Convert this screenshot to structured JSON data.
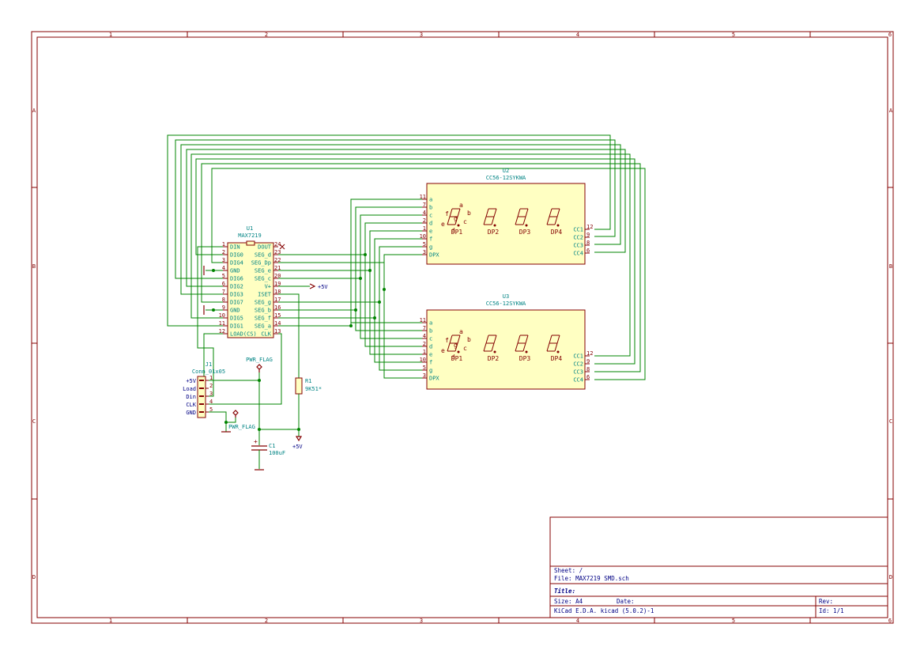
{
  "zones": {
    "columns": [
      "1",
      "2",
      "3",
      "4",
      "5",
      "6"
    ],
    "rows": [
      "A",
      "B",
      "C",
      "D"
    ]
  },
  "u1": {
    "ref": "U1",
    "value": "MAX7219",
    "left_pins": [
      {
        "num": "1",
        "name": "DIN"
      },
      {
        "num": "2",
        "name": "DIG0"
      },
      {
        "num": "3",
        "name": "DIG4"
      },
      {
        "num": "4",
        "name": "GND"
      },
      {
        "num": "5",
        "name": "DIG6"
      },
      {
        "num": "6",
        "name": "DIG2"
      },
      {
        "num": "7",
        "name": "DIG3"
      },
      {
        "num": "8",
        "name": "DIG7"
      },
      {
        "num": "9",
        "name": "GND"
      },
      {
        "num": "10",
        "name": "DIG5"
      },
      {
        "num": "11",
        "name": "DIG1"
      },
      {
        "num": "12",
        "name": "LOAD(CS)"
      }
    ],
    "right_pins": [
      {
        "num": "24",
        "name": "DOUT"
      },
      {
        "num": "23",
        "name": "SEG_d"
      },
      {
        "num": "22",
        "name": "SEG_Dp"
      },
      {
        "num": "21",
        "name": "SEG_e"
      },
      {
        "num": "20",
        "name": "SEG_c"
      },
      {
        "num": "19",
        "name": "V+"
      },
      {
        "num": "18",
        "name": "ISET"
      },
      {
        "num": "17",
        "name": "SEG_g"
      },
      {
        "num": "16",
        "name": "SEG_b"
      },
      {
        "num": "15",
        "name": "SEG_f"
      },
      {
        "num": "14",
        "name": "SEG_a"
      },
      {
        "num": "13",
        "name": "CLK"
      }
    ]
  },
  "u2": {
    "ref": "U2",
    "value": "CC56-12SYKWA",
    "left_pins": [
      {
        "num": "11",
        "name": "a"
      },
      {
        "num": "7",
        "name": "b"
      },
      {
        "num": "4",
        "name": "c"
      },
      {
        "num": "2",
        "name": "d"
      },
      {
        "num": "1",
        "name": "e"
      },
      {
        "num": "10",
        "name": "f"
      },
      {
        "num": "5",
        "name": "g"
      },
      {
        "num": "3",
        "name": "DPX"
      }
    ],
    "right_pins": [
      {
        "num": "12",
        "name": "CC1"
      },
      {
        "num": "9",
        "name": "CC2"
      },
      {
        "num": "8",
        "name": "CC3"
      },
      {
        "num": "6",
        "name": "CC4"
      }
    ],
    "digits": [
      "DP1",
      "DP2",
      "DP3",
      "DP4"
    ],
    "seg_letters": [
      "a",
      "b",
      "c",
      "d",
      "e",
      "f",
      "g"
    ]
  },
  "u3": {
    "ref": "U3",
    "value": "CC56-12SYKWA",
    "left_pins": [
      {
        "num": "11",
        "name": "a"
      },
      {
        "num": "7",
        "name": "b"
      },
      {
        "num": "4",
        "name": "c"
      },
      {
        "num": "2",
        "name": "d"
      },
      {
        "num": "1",
        "name": "e"
      },
      {
        "num": "10",
        "name": "f"
      },
      {
        "num": "5",
        "name": "g"
      },
      {
        "num": "3",
        "name": "DPX"
      }
    ],
    "right_pins": [
      {
        "num": "12",
        "name": "CC1"
      },
      {
        "num": "9",
        "name": "CC2"
      },
      {
        "num": "8",
        "name": "CC3"
      },
      {
        "num": "6",
        "name": "CC4"
      }
    ],
    "digits": [
      "DP1",
      "DP2",
      "DP3",
      "DP4"
    ],
    "seg_letters": [
      "a",
      "b",
      "c",
      "d",
      "e",
      "f",
      "g"
    ]
  },
  "j1": {
    "ref": "J1",
    "value": "Conn_01x05",
    "pins": [
      {
        "num": "1",
        "label": "+5V"
      },
      {
        "num": "2",
        "label": "Load"
      },
      {
        "num": "3",
        "label": "Din"
      },
      {
        "num": "4",
        "label": "CLK"
      },
      {
        "num": "5",
        "label": "GND"
      }
    ]
  },
  "r1": {
    "ref": "R1",
    "value": "9K51*"
  },
  "c1": {
    "ref": "C1",
    "value": "100uF"
  },
  "power": {
    "plus5v_1": "+5V",
    "plus5v_2": "+5V",
    "pwr_flag_1": "PWR_FLAG",
    "pwr_flag_2": "PWR_FLAG"
  },
  "title_block": {
    "sheet": "Sheet: /",
    "file": "File: MAX7219 SMD.sch",
    "title": "Title:",
    "size": "Size: A4",
    "date": "Date:",
    "rev": "Rev:",
    "tool": "KiCad E.D.A.  kicad (5.0.2)-1",
    "id": "Id: 1/1"
  },
  "colors": {
    "border": "#840000",
    "wire": "#008400",
    "body": "#ffffc2",
    "ref_text": "#008484",
    "label_text": "#000084"
  }
}
